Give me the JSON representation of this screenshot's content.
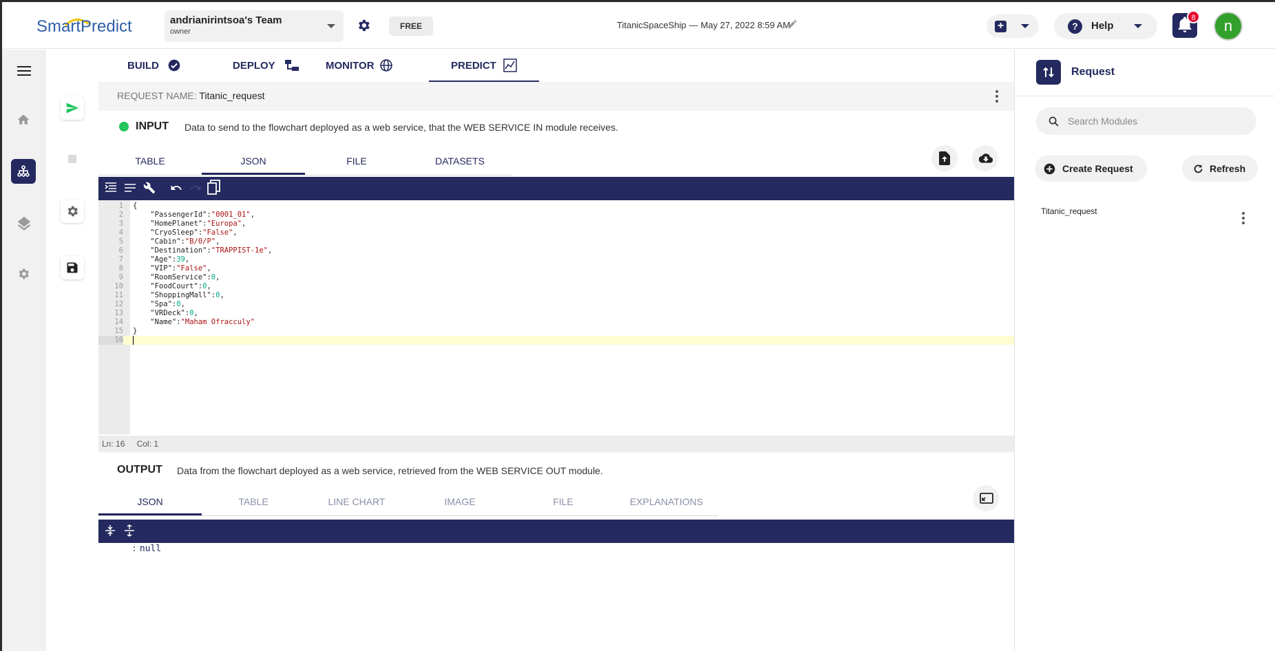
{
  "topbar": {
    "logo_text": "SmartPredict",
    "team_name": "andrianirintsoa's Team",
    "team_role": "owner",
    "plan": "FREE",
    "project_name": "TitanicSpaceShip",
    "project_sep": "—",
    "project_date": "May 27, 2022 8:59 AM",
    "help_label": "Help",
    "notification_count": "8",
    "avatar_letter": "n"
  },
  "main_tabs": [
    {
      "label": "BUILD",
      "icon": "check-circle-icon"
    },
    {
      "label": "DEPLOY",
      "icon": "deploy-icon"
    },
    {
      "label": "MONITOR",
      "icon": "globe-icon"
    },
    {
      "label": "PREDICT",
      "icon": "chart-icon",
      "active": true
    }
  ],
  "request": {
    "name_label": "REQUEST NAME:",
    "name_value": "Titanic_request"
  },
  "input": {
    "title": "INPUT",
    "description": "Data to send to the flowchart deployed as a web service, that the WEB SERVICE IN module receives.",
    "tabs": [
      "TABLE",
      "JSON",
      "FILE",
      "DATASETS"
    ],
    "active_tab": "JSON",
    "code_lines": [
      {
        "n": "1",
        "t": "{"
      },
      {
        "n": "2",
        "k": "    \"PassengerId\":",
        "v": "\"0001_01\"",
        "vt": "str",
        "e": ","
      },
      {
        "n": "3",
        "k": "    \"HomePlanet\":",
        "v": "\"Europa\"",
        "vt": "str",
        "e": ","
      },
      {
        "n": "4",
        "k": "    \"CryoSleep\":",
        "v": "\"False\"",
        "vt": "str",
        "e": ","
      },
      {
        "n": "5",
        "k": "    \"Cabin\":",
        "v": "\"B/0/P\"",
        "vt": "str",
        "e": ","
      },
      {
        "n": "6",
        "k": "    \"Destination\":",
        "v": "\"TRAPPIST-1e\"",
        "vt": "str",
        "e": ","
      },
      {
        "n": "7",
        "k": "    \"Age\":",
        "v": "39",
        "vt": "num",
        "e": ","
      },
      {
        "n": "8",
        "k": "    \"VIP\":",
        "v": "\"False\"",
        "vt": "str",
        "e": ","
      },
      {
        "n": "9",
        "k": "    \"RoomService\":",
        "v": "0",
        "vt": "num",
        "e": ","
      },
      {
        "n": "10",
        "k": "    \"FoodCourt\":",
        "v": "0",
        "vt": "num",
        "e": ","
      },
      {
        "n": "11",
        "k": "    \"ShoppingMall\":",
        "v": "0",
        "vt": "num",
        "e": ","
      },
      {
        "n": "12",
        "k": "    \"Spa\":",
        "v": "0",
        "vt": "num",
        "e": ","
      },
      {
        "n": "13",
        "k": "    \"VRDeck\":",
        "v": "0",
        "vt": "num",
        "e": ","
      },
      {
        "n": "14",
        "k": "    \"Name\":",
        "v": "\"Maham Ofracculy\"",
        "vt": "str",
        "e": ""
      },
      {
        "n": "15",
        "t": "}"
      },
      {
        "n": "16",
        "t": ""
      }
    ],
    "status_ln": "Ln: 16",
    "status_col": "Col: 1"
  },
  "output": {
    "title": "OUTPUT",
    "description": "Data from the flowchart deployed as a web service, retrieved from the WEB SERVICE OUT module.",
    "tabs": [
      "JSON",
      "TABLE",
      "LINE CHART",
      "IMAGE",
      "FILE",
      "EXPLANATIONS"
    ],
    "active_tab": "JSON",
    "value_colon": ":",
    "value": "null"
  },
  "right_panel": {
    "title": "Request",
    "search_placeholder": "Search Modules",
    "create_label": "Create Request",
    "refresh_label": "Refresh",
    "requests": [
      "Titanic_request"
    ]
  },
  "colors": {
    "primary": "#24295f",
    "accent_green": "#22c55e",
    "badge_red": "#e4002b",
    "string_color": "#a11",
    "number_color": "#0a8",
    "logo_yellow": "#f5c400",
    "logo_blue": "#3a86c8"
  }
}
